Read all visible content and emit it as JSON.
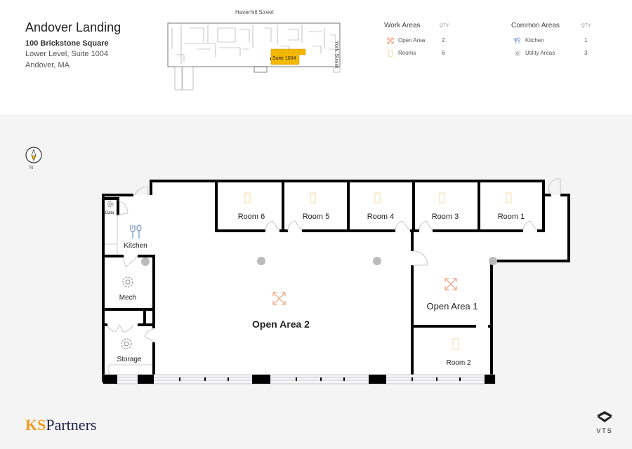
{
  "header": {
    "title": "Andover Landing",
    "address_line1": "100 Brickstone Square",
    "address_line2": "Lower Level, Suite 1004",
    "address_line3": "Andover, MA"
  },
  "keymap": {
    "street_top": "Haverhill Street",
    "street_right": "York Street",
    "suite_label": "Suite 1004",
    "highlight_color": "#f5b800"
  },
  "legend": {
    "work_areas": {
      "title": "Work Areas",
      "qty_header": "QTY",
      "items": [
        {
          "icon": "expand-arrows-icon",
          "label": "Open Area",
          "qty": "2"
        },
        {
          "icon": "door-icon",
          "label": "Rooms",
          "qty": "6"
        }
      ]
    },
    "common_areas": {
      "title": "Common Areas",
      "qty_header": "QTY",
      "items": [
        {
          "icon": "fork-spoon-icon",
          "label": "Kitchen",
          "qty": "1"
        },
        {
          "icon": "gear-icon",
          "label": "Utility Areas",
          "qty": "3"
        }
      ]
    }
  },
  "compass": {
    "label": "N"
  },
  "floorplan": {
    "rooms": {
      "room6": "Room 6",
      "room5": "Room 5",
      "room4": "Room 4",
      "room3": "Room 3",
      "room1": "Room 1",
      "room2": "Room 2",
      "open1": "Open Area 1",
      "open2": "Open Area 2",
      "kitchen": "Kitchen",
      "data": "Data",
      "mech": "Mech",
      "storage": "Storage"
    },
    "colors": {
      "open_area_icon": "#f4a07a",
      "room_icon": "#f8d9a0",
      "kitchen_icon": "#6a8fc7",
      "utility_icon": "#888888",
      "wall": "#000000",
      "column": "#bbbbbb"
    }
  },
  "footer": {
    "brand_ks": "KS",
    "brand_partners": "Partners",
    "vts_label": "VTS"
  }
}
